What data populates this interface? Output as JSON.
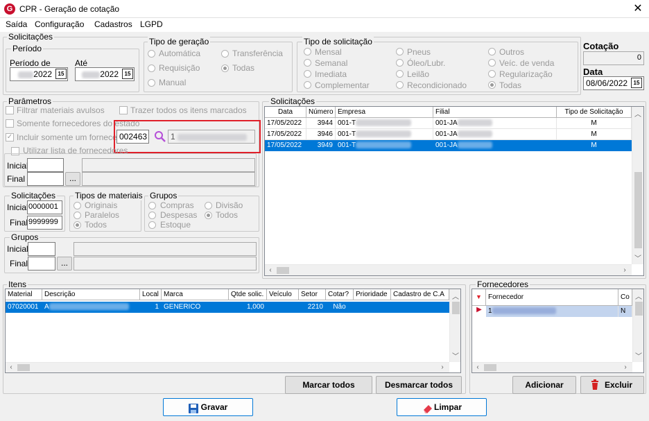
{
  "window": {
    "title": "CPR - Geração de cotação"
  },
  "menu": [
    "Saída",
    "Configuração",
    "Cadastros",
    "LGPD"
  ],
  "solicitacoes_group": {
    "legend": "Solicitações",
    "periodo": {
      "legend": "Período",
      "de_label": "Período de",
      "de_value": "2022",
      "ate_label": "Até",
      "ate_value": "2022",
      "cal_label": "15"
    }
  },
  "tipo_geracao": {
    "legend": "Tipo de geração",
    "options": [
      "Automática",
      "Transferência",
      "Requisição",
      "Todas",
      "Manual"
    ],
    "selected": "Todas"
  },
  "tipo_solicitacao": {
    "legend": "Tipo de solicitação",
    "options": [
      "Mensal",
      "Pneus",
      "Outros",
      "Semanal",
      "Óleo/Lubr.",
      "Veíc. de venda",
      "Imediata",
      "Leilão",
      "Regularização",
      "Complementar",
      "Recondicionado",
      "Todas"
    ],
    "selected": "Todas"
  },
  "cotacao": {
    "label": "Cotação",
    "value": "0",
    "data_label": "Data",
    "data_value": "08/06/2022",
    "cal_label": "15"
  },
  "parametros": {
    "legend": "Parâmetros",
    "filtrar": "Filtrar materiais avulsos",
    "trazer": "Trazer todos os itens marcados",
    "somente": "Somente fornecedores do estado",
    "incluir": "Incluir somente um fornecedor",
    "fornecedor_code": "002463",
    "fornecedor_name": "1",
    "utilizar": "Utilizar lista de fornecedores",
    "inicial": "Inicial",
    "final": "Final",
    "ellipsis": "..."
  },
  "solicitacoes_sub": {
    "legend": "Solicitações",
    "inicial_label": "Inicial",
    "inicial_value": "0000001",
    "final_label": "Final",
    "final_value": "9999999"
  },
  "tipos_materiais": {
    "legend": "Tipos de materiais",
    "options": [
      "Originais",
      "Paralelos",
      "Todos"
    ],
    "selected": "Todos"
  },
  "grupos_opt": {
    "legend": "Grupos",
    "options": [
      "Compras",
      "Divisão",
      "Despesas",
      "Todos",
      "Estoque"
    ],
    "selected": "Todos"
  },
  "grupos_range": {
    "legend": "Grupos",
    "inicial": "Inicial",
    "final": "Final",
    "ellipsis": "..."
  },
  "solicitacoes_grid": {
    "legend": "Solicitações",
    "columns": [
      "Data",
      "Número",
      "Empresa",
      "Filial",
      "Tipo de Solicitação"
    ],
    "rows": [
      {
        "data": "17/05/2022",
        "numero": "3944",
        "empresa": "001-T",
        "filial": "001-JA",
        "tipo": "M"
      },
      {
        "data": "17/05/2022",
        "numero": "3946",
        "empresa": "001-T",
        "filial": "001-JA",
        "tipo": "M"
      },
      {
        "data": "17/05/2022",
        "numero": "3949",
        "empresa": "001-T",
        "filial": "001-JA",
        "tipo": "M"
      }
    ]
  },
  "itens": {
    "legend": "Itens",
    "columns": [
      "Material",
      "Descrição",
      "Local",
      "Marca",
      "Qtde solic.",
      "Veículo",
      "Setor",
      "Cotar?",
      "Prioridade",
      "Cadastro de C.A"
    ],
    "rows": [
      {
        "material": "07020001",
        "descricao": "A",
        "local": "1",
        "marca": "GENERICO",
        "qtde": "1,000",
        "veiculo": "",
        "setor": "2210",
        "cotar": "Não",
        "prioridade": "",
        "cadastro": ""
      }
    ],
    "marcar": "Marcar todos",
    "desmarcar": "Desmarcar todos"
  },
  "fornecedores": {
    "legend": "Fornecedores",
    "columns": [
      "Fornecedor",
      "Co"
    ],
    "rows": [
      {
        "fornecedor": "1",
        "co": "N"
      }
    ],
    "adicionar": "Adicionar",
    "excluir": "Excluir"
  },
  "footer": {
    "gravar": "Gravar",
    "limpar": "Limpar"
  },
  "colors": {
    "selection": "#0078d7",
    "highlight_frame": "#e0202a"
  }
}
